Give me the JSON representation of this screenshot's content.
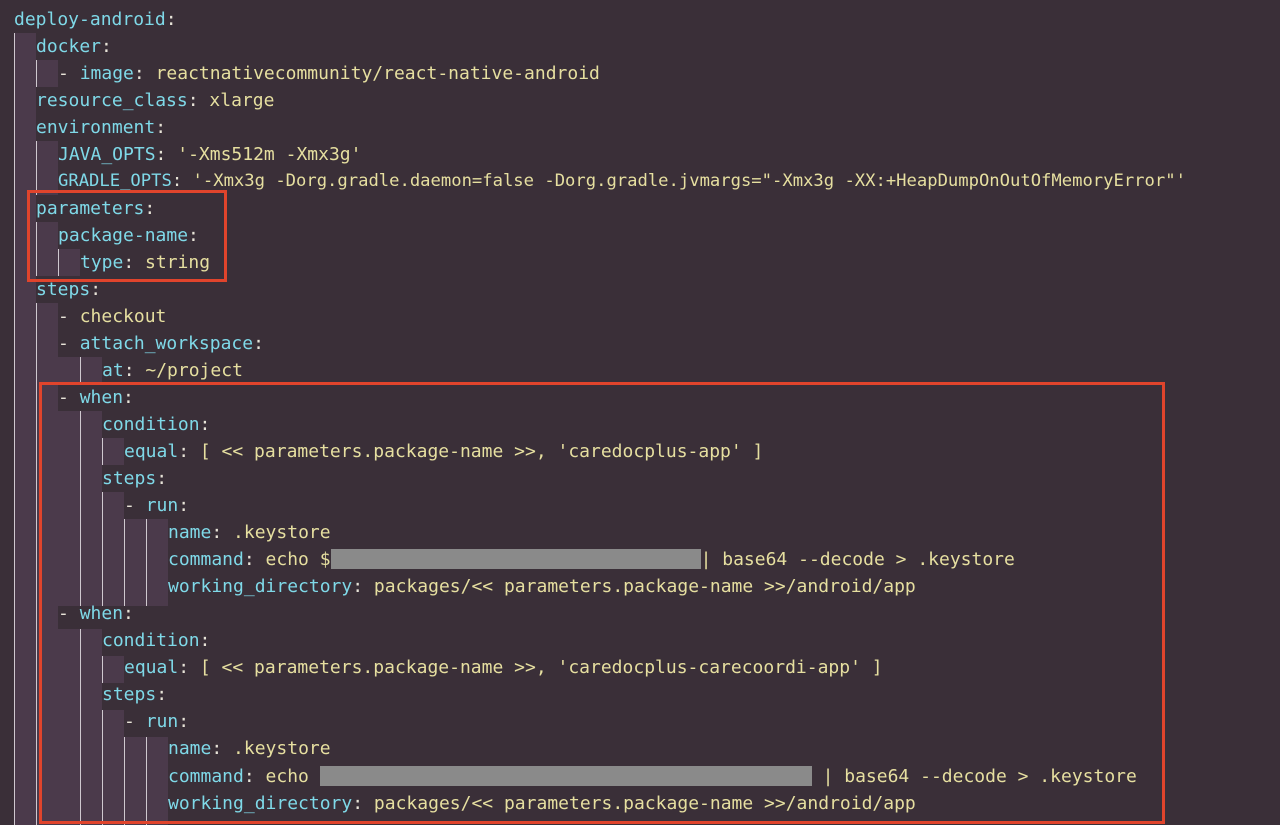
{
  "lines": [
    {
      "key": "deploy-android",
      "sep": ":",
      "value": ""
    },
    {
      "key": "docker",
      "sep": ":",
      "value": ""
    },
    {
      "dash": "- ",
      "key": "image",
      "sep": ": ",
      "value": "reactnativecommunity/react-native-android"
    },
    {
      "key": "resource_class",
      "sep": ": ",
      "value": "xlarge"
    },
    {
      "key": "environment",
      "sep": ":",
      "value": ""
    },
    {
      "key": "JAVA_OPTS",
      "sep": ": ",
      "value": "'-Xms512m -Xmx3g'"
    },
    {
      "key": "GRADLE_OPTS",
      "sep": ": ",
      "value": "'-Xmx3g -Dorg.gradle.daemon=false -Dorg.gradle.jvmargs=\"-Xmx3g -XX:+HeapDumpOnOutOfMemoryError\"'"
    },
    {
      "key": "parameters",
      "sep": ":",
      "value": ""
    },
    {
      "key": "package-name",
      "sep": ":",
      "value": ""
    },
    {
      "key": "type",
      "sep": ": ",
      "value": "string"
    },
    {
      "key": "steps",
      "sep": ":",
      "value": ""
    },
    {
      "dash": "- ",
      "key": "",
      "sep": "",
      "value": "checkout"
    },
    {
      "dash": "- ",
      "key": "attach_workspace",
      "sep": ":",
      "value": ""
    },
    {
      "key": "at",
      "sep": ": ",
      "value": "~/project"
    },
    {
      "dash": "- ",
      "key": "when",
      "sep": ":",
      "value": ""
    },
    {
      "key": "condition",
      "sep": ":",
      "value": ""
    },
    {
      "key": "equal",
      "sep": ": ",
      "value": "[ << parameters.package-name >>, 'caredocplus-app' ]"
    },
    {
      "key": "steps",
      "sep": ":",
      "value": ""
    },
    {
      "dash": "- ",
      "key": "run",
      "sep": ":",
      "value": ""
    },
    {
      "key": "name",
      "sep": ": ",
      "value": ".keystore"
    },
    {
      "key": "command",
      "sep": ": ",
      "value": "echo $",
      "value_after": "| base64 --decode > .keystore"
    },
    {
      "key": "working_directory",
      "sep": ": ",
      "value": "packages/<< parameters.package-name >>/android/app"
    },
    {
      "dash": "- ",
      "key": "when",
      "sep": ":",
      "value": ""
    },
    {
      "key": "condition",
      "sep": ":",
      "value": ""
    },
    {
      "key": "equal",
      "sep": ": ",
      "value": "[ << parameters.package-name >>, 'caredocplus-carecoordi-app' ]"
    },
    {
      "key": "steps",
      "sep": ":",
      "value": ""
    },
    {
      "dash": "- ",
      "key": "run",
      "sep": ":",
      "value": ""
    },
    {
      "key": "name",
      "sep": ": ",
      "value": ".keystore"
    },
    {
      "key": "command",
      "sep": ": ",
      "value": "echo ",
      "value_after": " | base64 --decode > .keystore"
    },
    {
      "key": "working_directory",
      "sep": ": ",
      "value": "packages/<< parameters.package-name >>/android/app"
    }
  ],
  "colors": {
    "background": "#3a2f38",
    "key": "#7fd9e8",
    "value": "#e6dfa0",
    "punctuation": "#e8e4d8",
    "highlight": "#e0442c",
    "redaction": "#8a8a8a"
  }
}
